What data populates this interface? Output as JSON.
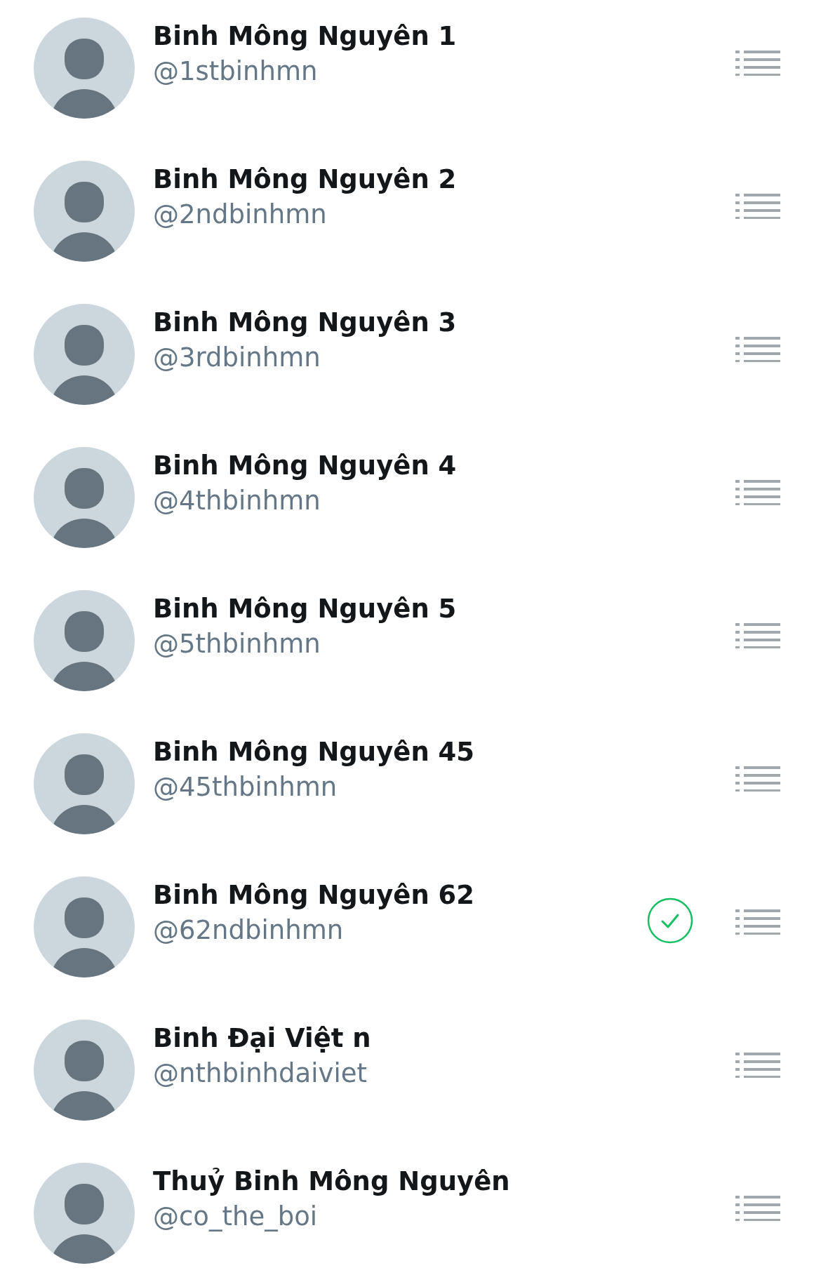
{
  "accounts": [
    {
      "name": "Binh Mông Nguyên 1",
      "handle": "@1stbinhmn",
      "verified": false
    },
    {
      "name": "Binh Mông Nguyên 2",
      "handle": "@2ndbinhmn",
      "verified": false
    },
    {
      "name": "Binh Mông Nguyên 3",
      "handle": "@3rdbinhmn",
      "verified": false
    },
    {
      "name": "Binh Mông Nguyên 4",
      "handle": "@4thbinhmn",
      "verified": false
    },
    {
      "name": "Binh Mông Nguyên 5",
      "handle": "@5thbinhmn",
      "verified": false
    },
    {
      "name": "Binh Mông Nguyên 45",
      "handle": "@45thbinhmn",
      "verified": false
    },
    {
      "name": "Binh Mông Nguyên 62",
      "handle": "@62ndbinhmn",
      "verified": true
    },
    {
      "name": "Binh Đại Việt n",
      "handle": "@nthbinhdaiviet",
      "verified": false
    },
    {
      "name": "Thuỷ Binh Mông Nguyên",
      "handle": "@co_the_boi",
      "verified": false
    }
  ]
}
